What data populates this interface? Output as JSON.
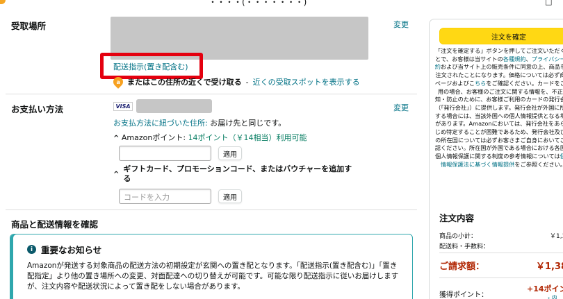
{
  "header": {
    "title": "・・・・(・・・・・・・)",
    "right_glyph": "□"
  },
  "delivery": {
    "section_title": "受取場所",
    "change_label": "変更",
    "instruction_link": "配送指示(置き配含む)",
    "pickup_bold": "またはこの住所の近くで受け取る",
    "pickup_sep": " - ",
    "pickup_link": "近くの受取スポットを表示する"
  },
  "payment": {
    "section_title": "お支払い方法",
    "change_label": "変更",
    "card_brand": "VISA",
    "billing_link": "お支払方法に紐づいた住所:",
    "billing_text": " お届け先と同じです。",
    "points_prefix": "Amazonポイント: ",
    "points_value": "14ポイント（￥14相当）利用可能",
    "apply_label": "適用",
    "gift_label": "ギフトカード、プロモーションコード、またはバウチャーを追加する",
    "code_placeholder": "コードを入力",
    "apply_label_2": "適用"
  },
  "review": {
    "section_title": "商品と配送情報を確認",
    "notice_title": "重要なお知らせ",
    "notice_body": "Amazonが発送する対象商品の配送方法の初期設定が玄関への置き配となります。「配送指示(置き配含む)」「置き配指定」より他の置き場所への変更、対面配達への切り替えが可能です。可能な限り配送指示に従いお届けしますが、注文内容や配送状況によって置き配をしない場合があります。"
  },
  "sidebar": {
    "place_order_label": "注文を確定",
    "terms_1": "「注文を確定する」ボタンを押してご注文いただくことで、お客様は当サイトの",
    "terms_link_1": "各種規約",
    "terms_2": "、",
    "terms_link_2": "プライバシー規約",
    "terms_3": "および当サイト上の販売条件に同意の上、商品をご注文されたことになります。価格については必ず商品ページおよびこ",
    "terms_link_3": "ちら",
    "terms_4": "をご確認ください。カードをご利用の場合、お客様のご注文に関する情報を、不正検知・防止のために、お客様ご利用のカードの発行会社（「発行会社」）に提供します。発行会社が外国に所在する場合には、当該外国への個人情報提供となる場合があります。Amazonにおいては、発行会社をあらかじめ特定することが困難であるため、発行会社及びその所在国については必ずお客さまご自身においてご確認ください。所在国が外国である場合における各国の個人情報保護に関する制度の参考情報については",
    "terms_link_4": "個人情報保護法に基づく情報提供",
    "terms_5": "をご参照ください。",
    "summary_title": "注文内容",
    "subtotal_label": "商品の小計：",
    "subtotal_value": "￥1,3",
    "shipping_label": "配送料・手数料：",
    "total_label": "ご請求額：",
    "total_value": "￥1,38",
    "points_label": "獲得ポイント：",
    "points_value": "+14ポイン",
    "points_sub": "› 内"
  }
}
